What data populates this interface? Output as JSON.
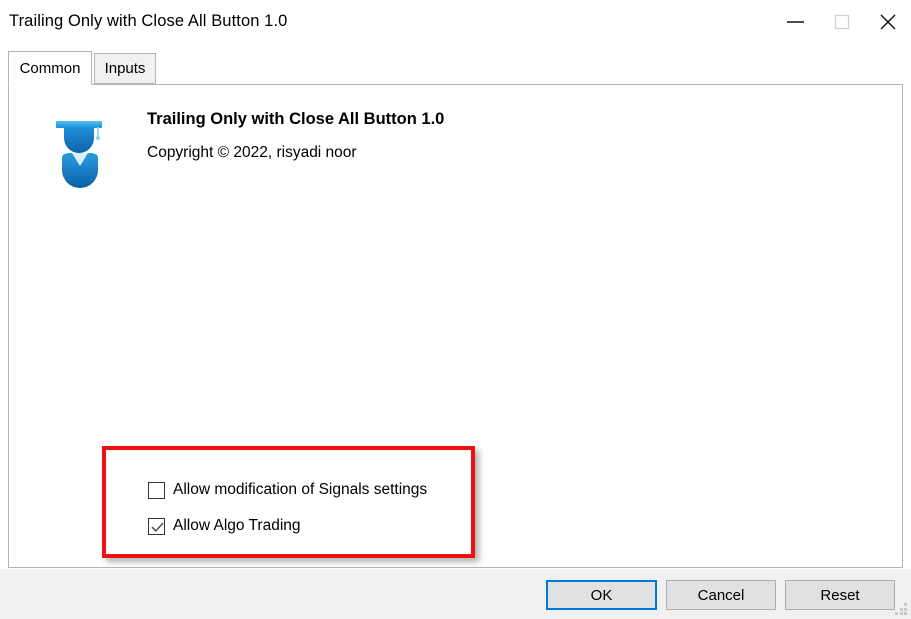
{
  "window": {
    "title": "Trailing Only with Close All Button 1.0",
    "caption_buttons": [
      {
        "name": "minimize",
        "label": "Minimize",
        "icon": "minimize-icon",
        "enabled": true
      },
      {
        "name": "maximize",
        "label": "Maximize",
        "icon": "maximize-icon",
        "enabled": false
      },
      {
        "name": "close",
        "label": "Close",
        "icon": "close-icon",
        "enabled": true
      }
    ]
  },
  "tabs": [
    {
      "label": "Common",
      "active": true
    },
    {
      "label": "Inputs",
      "active": false
    }
  ],
  "expert": {
    "icon": "expert-advisor-graduate-icon",
    "name": "Trailing Only with Close All Button 1.0",
    "copyright": "Copyright © 2022, risyadi noor"
  },
  "options": [
    {
      "label": "Allow modification of Signals settings",
      "checked": false
    },
    {
      "label": "Allow Algo Trading",
      "checked": true
    }
  ],
  "annotation": {
    "shape": "rectangle",
    "color": "#ee1111"
  },
  "footer": {
    "ok_label": "OK",
    "cancel_label": "Cancel",
    "reset_label": "Reset"
  },
  "colors": {
    "accent": "#0078d7",
    "window_bg": "#ffffff",
    "chrome_bg": "#f0f0f0",
    "button_bg": "#e1e1e1",
    "border": "#b4b4b4",
    "annotation": "#ee1111",
    "icon_blue": "#1272c4"
  }
}
